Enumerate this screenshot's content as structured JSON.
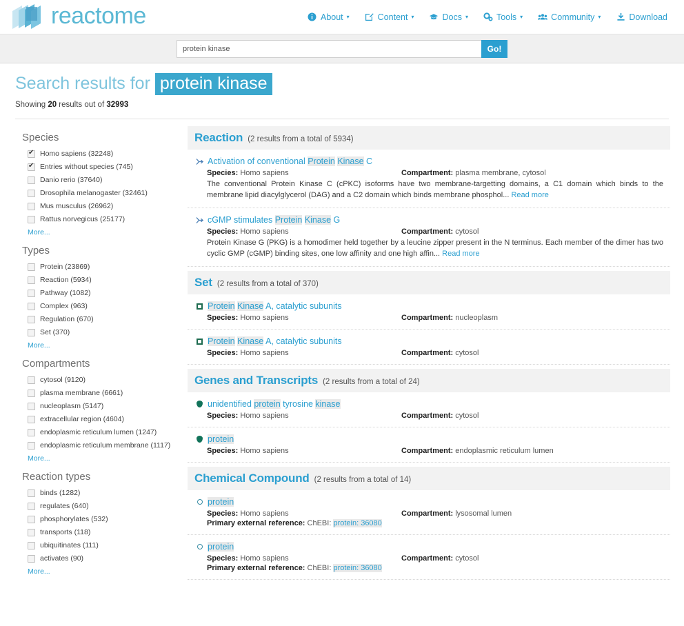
{
  "brand": {
    "name": "reactome",
    "logo_icon": "reactome-logo-icon"
  },
  "nav": {
    "items": [
      {
        "label": "About",
        "icon": "info-circle-icon",
        "caret": "▾"
      },
      {
        "label": "Content",
        "icon": "edit-square-icon",
        "caret": "▾"
      },
      {
        "label": "Docs",
        "icon": "graduation-cap-icon",
        "caret": "▾"
      },
      {
        "label": "Tools",
        "icon": "gears-icon",
        "caret": "▾"
      },
      {
        "label": "Community",
        "icon": "users-icon",
        "caret": "▾"
      },
      {
        "label": "Download",
        "icon": "download-icon",
        "caret": ""
      }
    ]
  },
  "search": {
    "value": "protein kinase",
    "placeholder": "protein kinase",
    "go_label": "Go!"
  },
  "title": {
    "prefix": "Search results for",
    "query": "protein kinase",
    "showing_prefix": "Showing ",
    "showing_count": "20",
    "showing_mid": " results out of ",
    "showing_total": "32993"
  },
  "facets": [
    {
      "title": "Species",
      "more_label": "More...",
      "items": [
        {
          "label": "Homo sapiens (32248)",
          "checked": true
        },
        {
          "label": "Entries without species (745)",
          "checked": true
        },
        {
          "label": "Danio rerio (37640)",
          "checked": false
        },
        {
          "label": "Drosophila melanogaster (32461)",
          "checked": false
        },
        {
          "label": "Mus musculus (26962)",
          "checked": false
        },
        {
          "label": "Rattus norvegicus (25177)",
          "checked": false
        }
      ]
    },
    {
      "title": "Types",
      "more_label": "More...",
      "items": [
        {
          "label": "Protein (23869)",
          "checked": false
        },
        {
          "label": "Reaction (5934)",
          "checked": false
        },
        {
          "label": "Pathway (1082)",
          "checked": false
        },
        {
          "label": "Complex (963)",
          "checked": false
        },
        {
          "label": "Regulation (670)",
          "checked": false
        },
        {
          "label": "Set (370)",
          "checked": false
        }
      ]
    },
    {
      "title": "Compartments",
      "more_label": "More...",
      "items": [
        {
          "label": "cytosol (9120)",
          "checked": false
        },
        {
          "label": "plasma membrane (6661)",
          "checked": false
        },
        {
          "label": "nucleoplasm (5147)",
          "checked": false
        },
        {
          "label": "extracellular region (4604)",
          "checked": false
        },
        {
          "label": "endoplasmic reticulum lumen (1247)",
          "checked": false
        },
        {
          "label": "endoplasmic reticulum membrane (1117)",
          "checked": false
        }
      ]
    },
    {
      "title": "Reaction types",
      "more_label": "More...",
      "items": [
        {
          "label": "binds (1282)",
          "checked": false
        },
        {
          "label": "regulates (640)",
          "checked": false
        },
        {
          "label": "phosphorylates (532)",
          "checked": false
        },
        {
          "label": "transports (118)",
          "checked": false
        },
        {
          "label": "ubiquitinates (111)",
          "checked": false
        },
        {
          "label": "activates (90)",
          "checked": false
        }
      ]
    }
  ],
  "sections": [
    {
      "name": "Reaction",
      "count": "(2 results from a total of 5934)",
      "icon": "reaction-arrow-icon",
      "entries": [
        {
          "title_parts": [
            {
              "t": "Activation of conventional ",
              "hl": false
            },
            {
              "t": "Protein",
              "hl": true
            },
            {
              "t": " ",
              "hl": false
            },
            {
              "t": "Kinase",
              "hl": true
            },
            {
              "t": " C",
              "hl": false
            }
          ],
          "species_label": "Species:",
          "species": "Homo sapiens",
          "compartment_label": "Compartment:",
          "compartment": "plasma membrane, cytosol",
          "description": "The conventional Protein Kinase C (cPKC) isoforms have two membrane-targetting domains, a C1 domain which binds to the membrane lipid diacylglycerol (DAG) and a C2 domain which binds membrane phosphol...",
          "read_more": "Read more"
        },
        {
          "title_parts": [
            {
              "t": "cGMP stimulates ",
              "hl": false
            },
            {
              "t": "Protein",
              "hl": true
            },
            {
              "t": " ",
              "hl": false
            },
            {
              "t": "Kinase",
              "hl": true
            },
            {
              "t": " G",
              "hl": false
            }
          ],
          "species_label": "Species:",
          "species": "Homo sapiens",
          "compartment_label": "Compartment:",
          "compartment": "cytosol",
          "description": "Protein Kinase G (PKG) is a homodimer held together by a leucine zipper present in the N terminus. Each member of the dimer has two cyclic GMP (cGMP) binding sites, one low affinity and one high affin...",
          "read_more": "Read more"
        }
      ]
    },
    {
      "name": "Set",
      "count": "(2 results from a total of 370)",
      "icon": "set-square-icon",
      "entries": [
        {
          "title_parts": [
            {
              "t": "Protein",
              "hl": true
            },
            {
              "t": " ",
              "hl": false
            },
            {
              "t": "Kinase",
              "hl": true
            },
            {
              "t": " A, catalytic subunits",
              "hl": false
            }
          ],
          "species_label": "Species:",
          "species": "Homo sapiens",
          "compartment_label": "Compartment:",
          "compartment": "nucleoplasm"
        },
        {
          "title_parts": [
            {
              "t": "Protein",
              "hl": true
            },
            {
              "t": " ",
              "hl": false
            },
            {
              "t": "Kinase",
              "hl": true
            },
            {
              "t": " A, catalytic subunits",
              "hl": false
            }
          ],
          "species_label": "Species:",
          "species": "Homo sapiens",
          "compartment_label": "Compartment:",
          "compartment": "cytosol"
        }
      ]
    },
    {
      "name": "Genes and Transcripts",
      "count": "(2 results from a total of 24)",
      "icon": "gene-diamond-icon",
      "entries": [
        {
          "title_parts": [
            {
              "t": "unidentified ",
              "hl": false
            },
            {
              "t": "protein",
              "hl": true
            },
            {
              "t": " tyrosine ",
              "hl": false
            },
            {
              "t": "kinase",
              "hl": true
            }
          ],
          "species_label": "Species:",
          "species": "Homo sapiens",
          "compartment_label": "Compartment:",
          "compartment": "cytosol"
        },
        {
          "title_parts": [
            {
              "t": "protein",
              "hl": true
            }
          ],
          "species_label": "Species:",
          "species": "Homo sapiens",
          "compartment_label": "Compartment:",
          "compartment": "endoplasmic reticulum lumen"
        }
      ]
    },
    {
      "name": "Chemical Compound",
      "count": "(2 results from a total of 14)",
      "icon": "chemical-circle-icon",
      "entries": [
        {
          "title_parts": [
            {
              "t": "protein",
              "hl": true
            }
          ],
          "species_label": "Species:",
          "species": "Homo sapiens",
          "compartment_label": "Compartment:",
          "compartment": "lysosomal lumen",
          "extref_label": "Primary external reference:",
          "extref_db": "ChEBI:",
          "extref_value": "protein: 36080"
        },
        {
          "title_parts": [
            {
              "t": "protein",
              "hl": true
            }
          ],
          "species_label": "Species:",
          "species": "Homo sapiens",
          "compartment_label": "Compartment:",
          "compartment": "cytosol",
          "extref_label": "Primary external reference:",
          "extref_db": "ChEBI:",
          "extref_value": "protein: 36080"
        }
      ]
    }
  ],
  "colors": {
    "accent": "#2b9fd0",
    "title": "#7ec4dd",
    "highlight_bg": "#3ba7cd",
    "section_bg": "#f2f2f2"
  }
}
